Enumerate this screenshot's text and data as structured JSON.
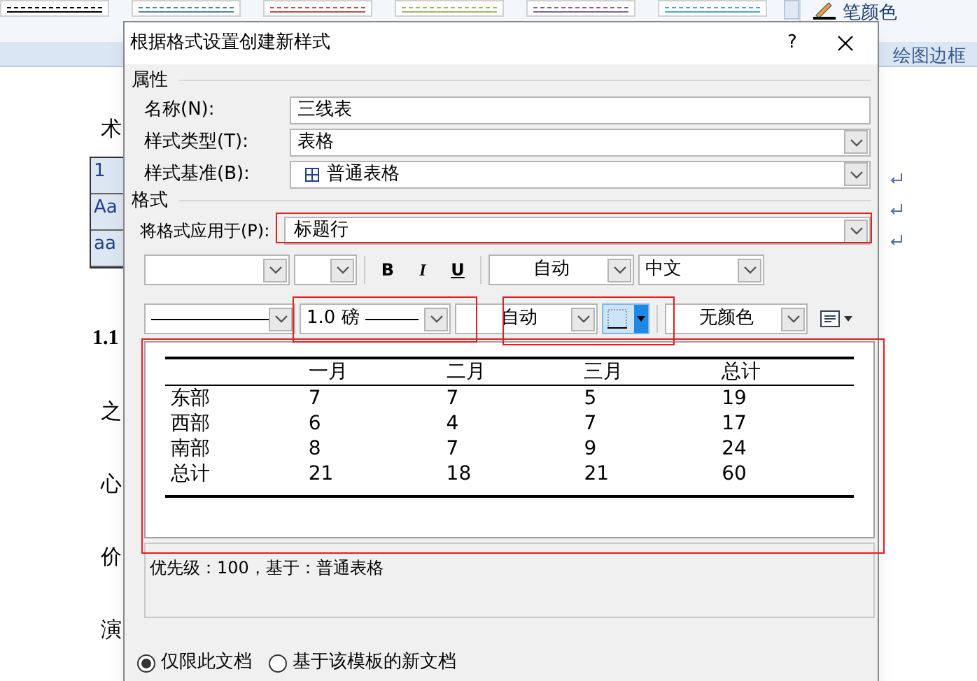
{
  "ribbon": {
    "pen_color": "笔颜色",
    "draw_borders": "绘图边框"
  },
  "document": {
    "first_char": "术",
    "table_cells": [
      "1",
      "Aa",
      "aa"
    ],
    "heading": "1.1",
    "lines": [
      "之",
      "心",
      "价",
      "演"
    ]
  },
  "dialog": {
    "title": "根据格式设置创建新样式",
    "help": "?",
    "properties": {
      "heading": "属性",
      "fields": [
        {
          "kind": "text",
          "label": "名称(N):",
          "value": "三线表"
        },
        {
          "kind": "dropdown",
          "label": "样式类型(T):",
          "value": "表格"
        },
        {
          "kind": "dropdown-table",
          "label": "样式基准(B):",
          "value": "普通表格"
        }
      ]
    },
    "format": {
      "heading": "格式",
      "apply_label": "将格式应用于(P):",
      "apply_value": "标题行",
      "font_color": "自动",
      "language": "中文",
      "border_width": "1.0 磅",
      "border_color": "自动",
      "shading": "无颜色",
      "bold": "B",
      "italic": "I",
      "underline": "U"
    },
    "preview": {
      "columns": [
        "",
        "一月",
        "二月",
        "三月",
        "总计"
      ],
      "rows": [
        [
          "东部",
          "7",
          "7",
          "5",
          "19"
        ],
        [
          "西部",
          "6",
          "4",
          "7",
          "17"
        ],
        [
          "南部",
          "8",
          "7",
          "9",
          "24"
        ],
        [
          "总计",
          "21",
          "18",
          "21",
          "60"
        ]
      ]
    },
    "description": "优先级：100，基于：普通表格",
    "options": [
      {
        "label": "仅限此文档",
        "selected": true
      },
      {
        "label": "基于该模板的新文档",
        "selected": false
      }
    ]
  }
}
